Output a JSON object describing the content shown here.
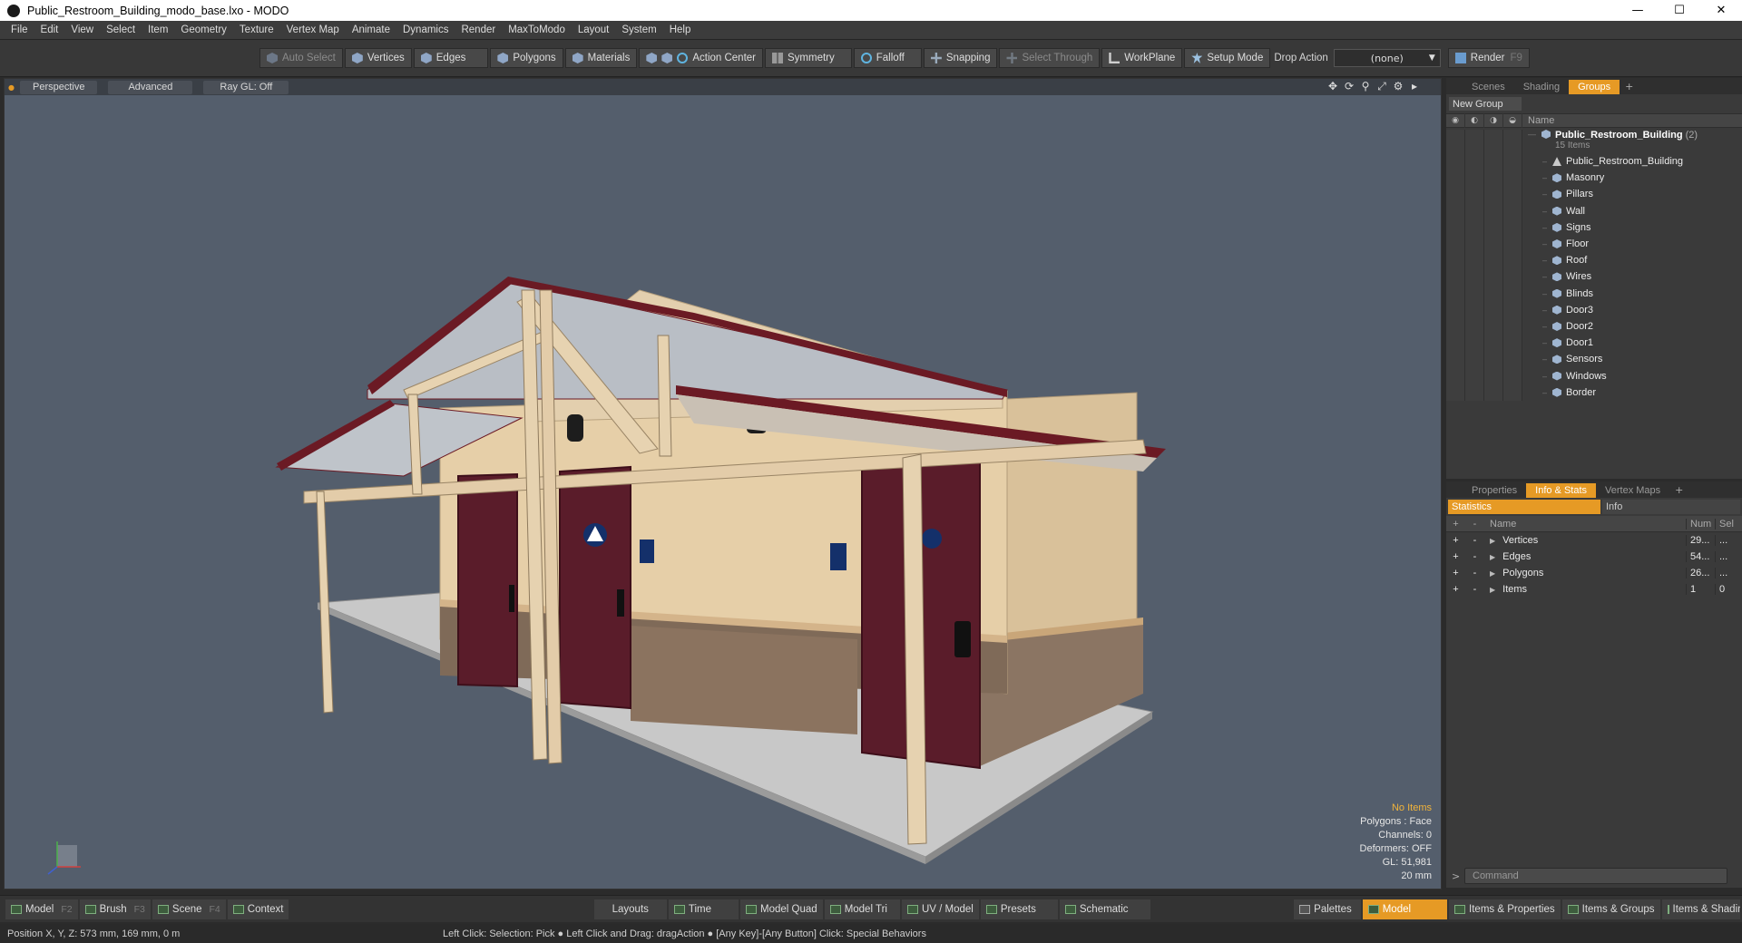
{
  "window": {
    "title": "Public_Restroom_Building_modo_base.lxo - MODO",
    "controls": [
      "—",
      "☐",
      "✕"
    ]
  },
  "menu": [
    "File",
    "Edit",
    "View",
    "Select",
    "Item",
    "Geometry",
    "Texture",
    "Vertex Map",
    "Animate",
    "Dynamics",
    "Render",
    "MaxToModo",
    "Layout",
    "System",
    "Help"
  ],
  "toolbar": {
    "auto_select": "Auto Select",
    "vertices": "Vertices",
    "edges": "Edges",
    "polygons": "Polygons",
    "materials": "Materials",
    "action_center": "Action Center",
    "symmetry": "Symmetry",
    "falloff": "Falloff",
    "snapping": "Snapping",
    "select_through": "Select Through",
    "workplane": "WorkPlane",
    "setup_mode": "Setup Mode",
    "drop_action_label": "Drop Action",
    "drop_action_value": "(none)",
    "render": "Render",
    "render_key": "F9"
  },
  "viewport": {
    "tabs": [
      "Perspective",
      "Advanced",
      "Ray GL: Off"
    ],
    "info": {
      "selection": "No Items",
      "polygons": "Polygons : Face",
      "channels": "Channels: 0",
      "deformers": "Deformers: OFF",
      "gl": "GL: 51,981",
      "scale": "20 mm"
    },
    "tools": [
      "✥",
      "⟳",
      "⚲",
      "⤢",
      "⚙",
      "▸"
    ]
  },
  "groups_panel": {
    "tabs": [
      "Scenes",
      "Shading",
      "Groups"
    ],
    "active_tab": "Groups",
    "new_group": "New Group",
    "column_name": "Name",
    "root": {
      "name": "Public_Restroom_Building",
      "count": "(2)",
      "sub": "15 Items"
    },
    "items": [
      "Public_Restroom_Building",
      "Masonry",
      "Pillars",
      "Wall",
      "Signs",
      "Floor",
      "Roof",
      "Wires",
      "Blinds",
      "Door3",
      "Door2",
      "Door1",
      "Sensors",
      "Windows",
      "Border"
    ]
  },
  "stats_panel": {
    "tabs": [
      "Properties",
      "Info & Stats",
      "Vertex Maps"
    ],
    "active_tab": "Info & Stats",
    "subtabs": [
      "Statistics",
      "Info"
    ],
    "headers": {
      "name": "Name",
      "num": "Num",
      "sel": "Sel"
    },
    "rows": [
      {
        "name": "Vertices",
        "num": "29...",
        "sel": "..."
      },
      {
        "name": "Edges",
        "num": "54...",
        "sel": "..."
      },
      {
        "name": "Polygons",
        "num": "26...",
        "sel": "..."
      },
      {
        "name": "Items",
        "num": "1",
        "sel": "0"
      }
    ],
    "command_placeholder": "Command"
  },
  "modebar": {
    "left": [
      {
        "label": "Model",
        "key": "F2"
      },
      {
        "label": "Brush",
        "key": "F3"
      },
      {
        "label": "Scene",
        "key": "F4"
      },
      {
        "label": "Context",
        "key": ""
      }
    ],
    "center": [
      "Layouts",
      "Time",
      "Model Quad",
      "Model Tri",
      "UV / Model",
      "Presets",
      "Schematic"
    ],
    "palettes": "Palettes",
    "model": "Model",
    "right": [
      "Items & Properties",
      "Items & Groups",
      "Items & Shading"
    ]
  },
  "status": {
    "position": "Position X, Y, Z:   573 mm, 169 mm, 0 m",
    "hint": "Left Click: Selection: Pick ● Left Click and Drag: dragAction ● [Any Key]-[Any Button] Click: Special Behaviors"
  },
  "colors": {
    "accent": "#e69a25",
    "viewport_bg": "#545e6c",
    "roof": "#6b1a24",
    "wall": "#e6cfa8",
    "door": "#5a1c2a",
    "sign": "#14306a"
  }
}
